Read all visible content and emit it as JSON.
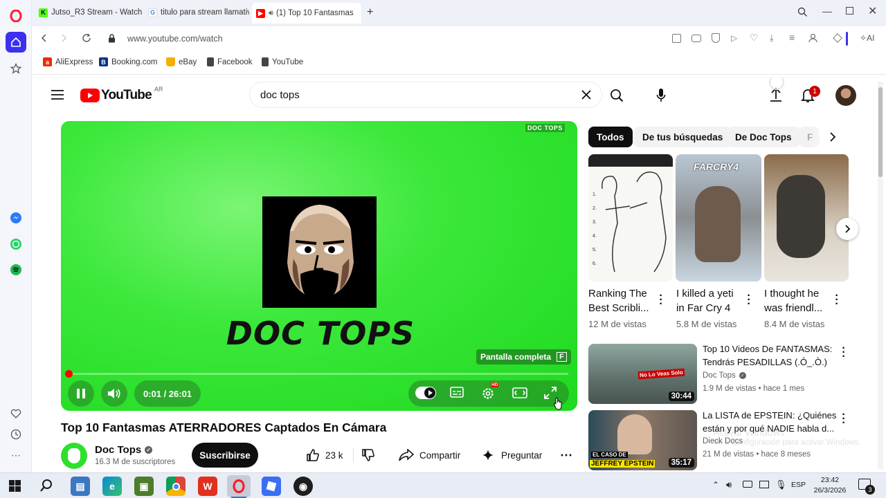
{
  "browser": {
    "tabs": [
      {
        "title": "Jutso_R3 Stream - Watch L"
      },
      {
        "title": "titulo para stream llamativ"
      },
      {
        "title": "(1) Top 10 Fantasmas"
      }
    ],
    "url": "www.youtube.com/watch",
    "ai_label": "AI",
    "bookmarks": [
      "AliExpress",
      "Booking.com",
      "eBay",
      "Facebook",
      "YouTube"
    ]
  },
  "youtube": {
    "logo_text": "YouTube",
    "country_code": "AR",
    "search_value": "doc tops",
    "notification_count": "1"
  },
  "player": {
    "channel_logo_text": "DOC TOPS",
    "watermark": "DOC TOPS",
    "fullscreen_tooltip": "Pantalla completa",
    "fullscreen_key": "F",
    "time": "0:01 / 26:01",
    "hd_badge": "HD",
    "progress": 0.001
  },
  "video": {
    "title": "Top 10 Fantasmas ATERRADORES Captados En Cámara",
    "channel": "Doc Tops",
    "subscribers": "16.3 M de suscriptores",
    "subscribe_label": "Suscribirse",
    "likes": "23 k",
    "share_label": "Compartir",
    "ask_label": "Preguntar"
  },
  "chips": [
    "Todos",
    "De tus búsquedas",
    "De Doc Tops",
    "F"
  ],
  "shorts": [
    {
      "title_l1": "Ranking The",
      "title_l2": "Best Scribli...",
      "views": "12 M de vistas"
    },
    {
      "title_l1": "I killed a yeti",
      "title_l2": "in Far Cry 4",
      "views": "5.8 M de vistas",
      "thumb_text": "FARCRY4"
    },
    {
      "title_l1": "I thought he",
      "title_l2": "was friendl...",
      "views": "8.4 M de vistas"
    }
  ],
  "recommendations": [
    {
      "title_l1": "Top 10 Videos De FANTASMAS:",
      "title_l2": "Tendrás PESADILLAS (.Ó_.Ò.)",
      "channel": "Doc Tops",
      "meta": "1.9 M de vistas • hace 1 mes",
      "duration": "30:44",
      "thumb_text": "No Lo Veas Solo"
    },
    {
      "title_l1": "La LISTA de EPSTEIN: ¿Quiénes",
      "title_l2": "están y por qué NADIE habla d...",
      "channel": "Dieck Docs",
      "meta": "21 M de vistas • hace 8 meses",
      "duration": "35:17",
      "thumb_text_1": "EL CASO DE",
      "thumb_text_2": "JEFFREY EPSTEIN"
    }
  ],
  "windows_watermark": "Activar Windows",
  "windows_watermark_sub": "Ve a Configuración para activar Windows.",
  "taskbar": {
    "lang": "ESP",
    "time": "23:42",
    "date": "26/3/2026",
    "notif_count": "3"
  },
  "colors": {
    "player_green": "#27e02a",
    "yt_red": "#ff0000",
    "opera_red": "#ff1b2d",
    "opera_blue": "#3b30f0"
  }
}
